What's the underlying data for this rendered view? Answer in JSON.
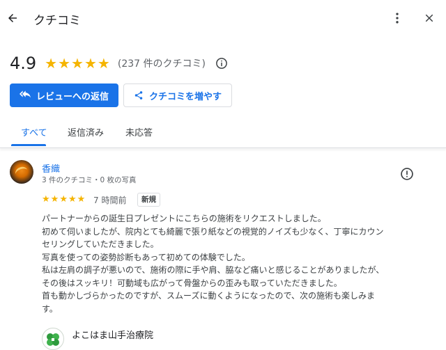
{
  "header": {
    "title": "クチコミ"
  },
  "summary": {
    "rating": "4.9",
    "stars": 5,
    "count_text": "(237 件のクチコミ)"
  },
  "actions": {
    "reply_label": "レビューへの返信",
    "get_more_label": "クチコミを増やす"
  },
  "tabs": [
    {
      "label": "すべて",
      "active": true
    },
    {
      "label": "返信済み",
      "active": false
    },
    {
      "label": "未応答",
      "active": false
    }
  ],
  "review": {
    "author": "香織",
    "author_meta": "3 件のクチコミ・0 枚の写真",
    "stars": 5,
    "time": "7 時間前",
    "badge": "新規",
    "lines": [
      "パートナーからの誕生日プレゼントにこちらの施術をリクエストしました。",
      "初めて伺いましたが、院内とても綺麗で張り紙などの視覚的ノイズも少なく、丁寧にカウン",
      "セリングしていただきました。",
      "写真を使っての姿勢診断もあって初めての体験でした。",
      "私は左肩の調子が悪いので、施術の際に手や肩、脇など痛いと感じることがありましたが、",
      "その後はスッキリ！可動域も広がって骨盤からの歪みも取っていただきました。",
      "首も動かしづらかったのですが、スムーズに動くようになったので、次の施術も楽しみま",
      "す。"
    ]
  },
  "owner": {
    "name": "よこはま山手治療院"
  },
  "colors": {
    "accent": "#1a73e8",
    "star": "#f5b400"
  }
}
